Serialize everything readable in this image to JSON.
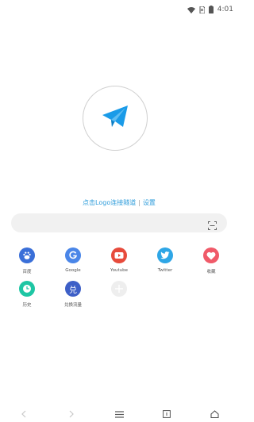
{
  "status": {
    "time": "4:01"
  },
  "tunnel": {
    "prompt": "点击Logo连接隧道",
    "separator": "|",
    "settings": "设置"
  },
  "shortcuts": [
    {
      "label": "百度",
      "icon": "baidu-paw-icon",
      "color": "#3a6fd8"
    },
    {
      "label": "Google",
      "icon": "google-g-icon",
      "color": "#4a86e8"
    },
    {
      "label": "Youtube",
      "icon": "youtube-play-icon",
      "color": "#e74b3c"
    },
    {
      "label": "Twitter",
      "icon": "twitter-bird-icon",
      "color": "#2ea6e6"
    },
    {
      "label": "收藏",
      "icon": "heart-icon",
      "color": "#f05a69"
    },
    {
      "label": "历史",
      "icon": "clock-icon",
      "color": "#1ec6a4"
    },
    {
      "label": "兑换流量",
      "icon": "exchange-icon",
      "color": "#3d5fc7",
      "glyph": "兑"
    }
  ],
  "colors": {
    "accent": "#2d9cdb",
    "logo": "#1a9be8"
  }
}
